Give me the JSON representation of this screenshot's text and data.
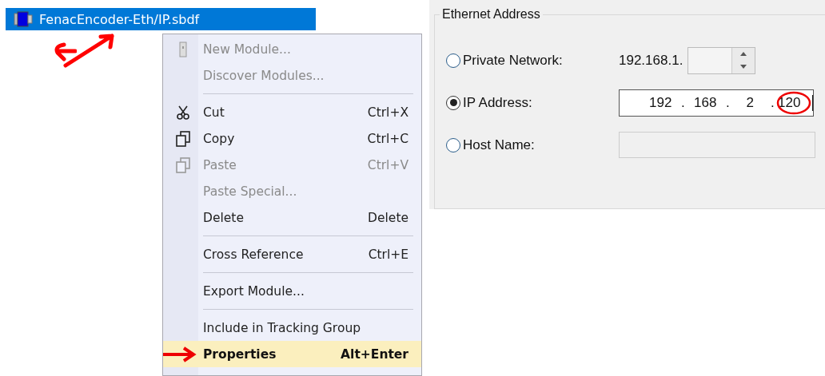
{
  "tree": {
    "items": [
      {
        "label": "FenacEncoder-Eth/IP.sbdf",
        "selected": true
      }
    ]
  },
  "context_menu": {
    "items": [
      {
        "kind": "item",
        "label": "New Module...",
        "disabled": true,
        "selected": false
      },
      {
        "kind": "item",
        "label": "Discover Modules...",
        "disabled": true,
        "selected": false
      },
      {
        "kind": "separator"
      },
      {
        "kind": "item",
        "label": "Cut",
        "shortcut": "Ctrl+X",
        "disabled": false,
        "selected": false
      },
      {
        "kind": "item",
        "label": "Copy",
        "shortcut": "Ctrl+C",
        "disabled": false,
        "selected": false
      },
      {
        "kind": "item",
        "label": "Paste",
        "shortcut": "Ctrl+V",
        "disabled": true,
        "selected": false
      },
      {
        "kind": "item",
        "label": "Paste Special...",
        "disabled": true,
        "selected": false
      },
      {
        "kind": "item",
        "label": "Delete",
        "shortcut": "Delete",
        "disabled": false,
        "selected": false
      },
      {
        "kind": "separator"
      },
      {
        "kind": "item",
        "label": "Cross Reference",
        "shortcut": "Ctrl+E",
        "disabled": false,
        "selected": false
      },
      {
        "kind": "separator"
      },
      {
        "kind": "item",
        "label": "Export Module...",
        "disabled": false,
        "selected": false
      },
      {
        "kind": "separator"
      },
      {
        "kind": "item",
        "label": "Include in Tracking Group",
        "disabled": false,
        "selected": false
      },
      {
        "kind": "item",
        "label": "Properties",
        "shortcut": "Alt+Enter",
        "disabled": false,
        "selected": true
      }
    ]
  },
  "ethernet_address": {
    "title": "Ethernet Address",
    "options": [
      {
        "kind": "spinner",
        "label": "Private Network:",
        "selected": false,
        "prefix": "192.168.1."
      },
      {
        "kind": "ip",
        "label": "IP Address:",
        "selected": true,
        "octets": [
          "192",
          "168",
          "2",
          "120"
        ],
        "separator": "."
      },
      {
        "kind": "text",
        "label": "Host Name:",
        "selected": false
      }
    ]
  }
}
